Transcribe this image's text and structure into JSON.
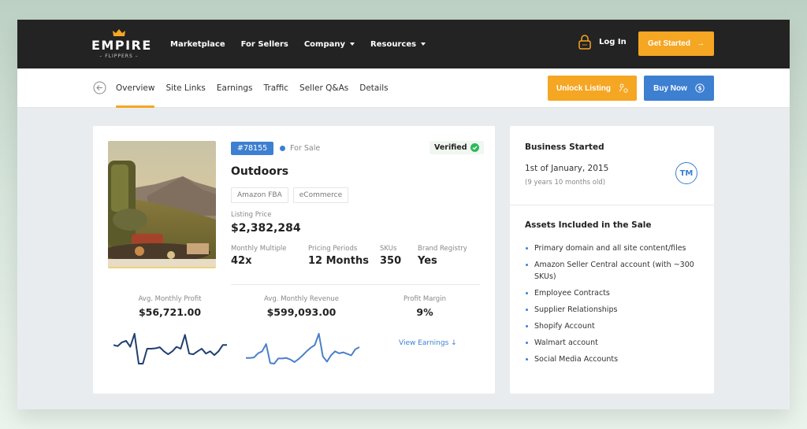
{
  "brand": {
    "name": "EMPIRE",
    "sub": "FLIPPERS",
    "accent": "#f5a623",
    "blue": "#3d7fd0"
  },
  "topnav": {
    "links": [
      {
        "label": "Marketplace",
        "dropdown": false
      },
      {
        "label": "For Sellers",
        "dropdown": false
      },
      {
        "label": "Company",
        "dropdown": true
      },
      {
        "label": "Resources",
        "dropdown": true
      }
    ],
    "login_label": "Log In",
    "get_started_label": "Get Started"
  },
  "subnav": {
    "tabs": [
      "Overview",
      "Site Links",
      "Earnings",
      "Traffic",
      "Seller Q&As",
      "Details"
    ],
    "active_tab": "Overview",
    "unlock_label": "Unlock Listing",
    "buy_label": "Buy Now"
  },
  "listing": {
    "id": "#78155",
    "status": "For Sale",
    "verified_label": "Verified",
    "title": "Outdoors",
    "tags": [
      "Amazon FBA",
      "eCommerce"
    ],
    "price_label": "Listing Price",
    "price": "$2,382,284",
    "stats": [
      {
        "label": "Monthly Multiple",
        "value": "42x"
      },
      {
        "label": "Pricing Periods",
        "value": "12 Months"
      },
      {
        "label": "SKUs",
        "value": "350"
      },
      {
        "label": "Brand Registry",
        "value": "Yes"
      }
    ],
    "metrics": [
      {
        "label": "Avg. Monthly Profit",
        "value": "$56,721.00"
      },
      {
        "label": "Avg. Monthly Revenue",
        "value": "$599,093.00"
      },
      {
        "label": "Profit Margin",
        "value": "9%"
      }
    ],
    "view_earnings_label": "View Earnings ↓",
    "profit_trend": [
      55,
      52,
      62,
      66,
      50,
      85,
      5,
      5,
      45,
      45,
      46,
      49,
      38,
      30,
      38,
      50,
      45,
      82,
      32,
      30,
      38,
      45,
      32,
      38,
      28,
      38,
      55,
      55
    ],
    "revenue_trend": [
      35,
      35,
      36,
      44,
      48,
      62,
      25,
      24,
      34,
      34,
      35,
      32,
      27,
      33,
      40,
      48,
      55,
      60,
      82,
      38,
      28,
      40,
      48,
      44,
      46,
      43,
      40,
      52,
      56
    ]
  },
  "side": {
    "business_started_title": "Business Started",
    "business_started_date": "1st of January, 2015",
    "business_age": "(9 years 10 months old)",
    "tm_badge": "TM",
    "assets_title": "Assets Included in the Sale",
    "assets": [
      "Primary domain and all site content/files",
      "Amazon Seller Central account (with ~300 SKUs)",
      "Employee Contracts",
      "Supplier Relationships",
      "Shopify Account",
      "Walmart account",
      "Social Media Accounts"
    ]
  }
}
